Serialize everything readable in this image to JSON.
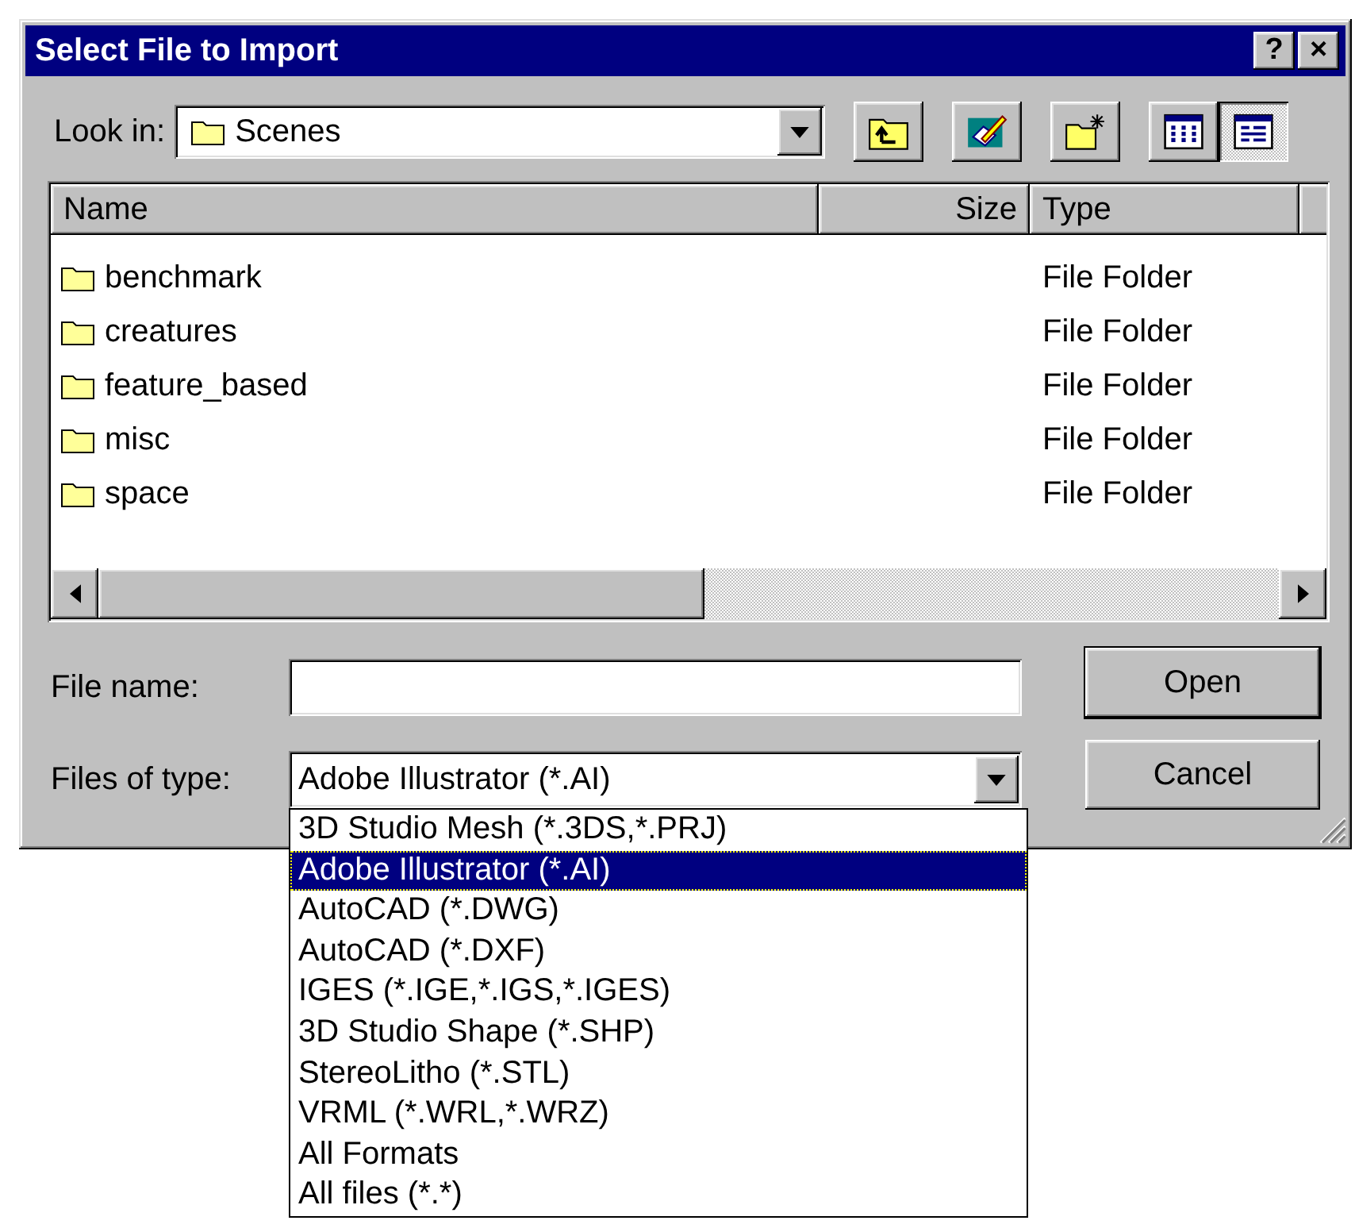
{
  "window": {
    "title": "Select File to Import",
    "buttons": [
      "?",
      "×"
    ]
  },
  "look_in": {
    "label": "Look in:",
    "value": "Scenes"
  },
  "view_buttons": [
    {
      "kind": "list",
      "selected": false
    },
    {
      "kind": "details",
      "selected": true
    }
  ],
  "file_list": {
    "columns": [
      "Name",
      "Size",
      "Type"
    ],
    "rows": [
      {
        "name": "benchmark",
        "type": "File Folder"
      },
      {
        "name": "creatures",
        "type": "File Folder"
      },
      {
        "name": "feature_based",
        "type": "File Folder"
      },
      {
        "name": "misc",
        "type": "File Folder"
      },
      {
        "name": "space",
        "type": "File Folder"
      }
    ]
  },
  "file_name": {
    "label": "File name:"
  },
  "files_of_type": {
    "label": "Files of type:",
    "value": "Adobe Illustrator (*.AI)",
    "expanded": true,
    "options": [
      {
        "label": "3D Studio Mesh (*.3DS,*.PRJ)",
        "selected": false
      },
      {
        "label": "Adobe Illustrator (*.AI)",
        "selected": true
      },
      {
        "label": "AutoCAD (*.DWG)",
        "selected": false
      },
      {
        "label": "AutoCAD (*.DXF)",
        "selected": false
      },
      {
        "label": "IGES (*.IGE,*.IGS,*.IGES)",
        "selected": false
      },
      {
        "label": "3D Studio Shape (*.SHP)",
        "selected": false
      },
      {
        "label": "StereoLitho (*.STL)",
        "selected": false
      },
      {
        "label": "VRML (*.WRL,*.WRZ)",
        "selected": false
      },
      {
        "label": "All Formats",
        "selected": false
      },
      {
        "label": "All files (*.*)",
        "selected": false
      }
    ]
  },
  "buttons": [
    {
      "label": "Open",
      "default": true
    },
    {
      "label": "Cancel",
      "default": false
    }
  ]
}
